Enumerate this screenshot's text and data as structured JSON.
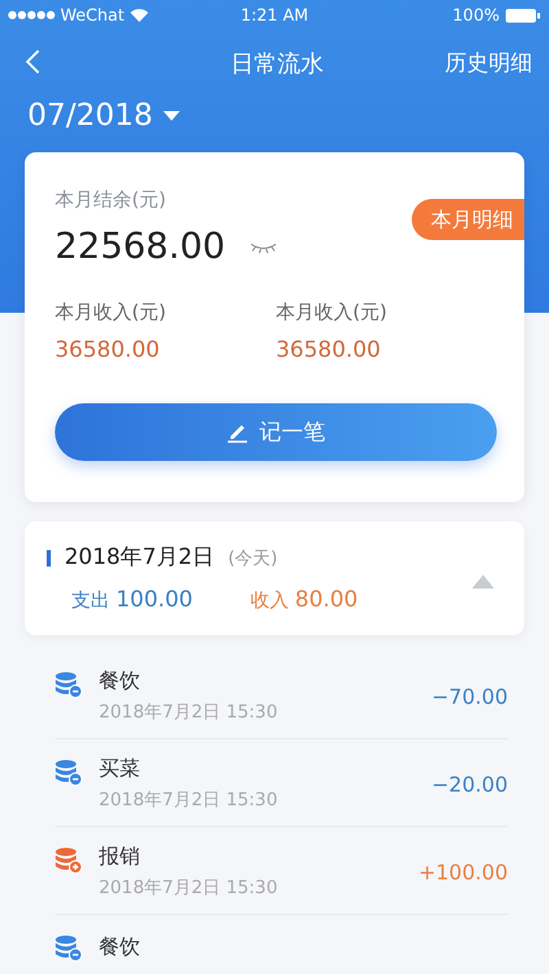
{
  "status_bar": {
    "carrier": "WeChat",
    "time": "1:21 AM",
    "battery": "100%"
  },
  "nav": {
    "title": "日常流水",
    "action": "历史明细"
  },
  "month": {
    "label": "07/2018"
  },
  "summary": {
    "balance_label": "本月结余(元)",
    "balance": "22568.00",
    "detail_badge": "本月明细",
    "stats": [
      {
        "label": "本月收入(元)",
        "value": "36580.00"
      },
      {
        "label": "本月收入(元)",
        "value": "36580.00"
      }
    ],
    "record_button": "记一笔"
  },
  "day": {
    "date": "2018年7月2日",
    "note": "(今天)",
    "expense_label": "支出",
    "expense": "100.00",
    "income_label": "收入",
    "income": "80.00",
    "expanded": true
  },
  "entries": [
    {
      "kind": "expense",
      "title": "餐饮",
      "time": "2018年7月2日 15:30",
      "amount": "−70.00"
    },
    {
      "kind": "expense",
      "title": "买菜",
      "time": "2018年7月2日 15:30",
      "amount": "−20.00"
    },
    {
      "kind": "income",
      "title": "报销",
      "time": "2018年7月2日 15:30",
      "amount": "+100.00"
    },
    {
      "kind": "expense",
      "title": "餐饮"
    }
  ]
}
